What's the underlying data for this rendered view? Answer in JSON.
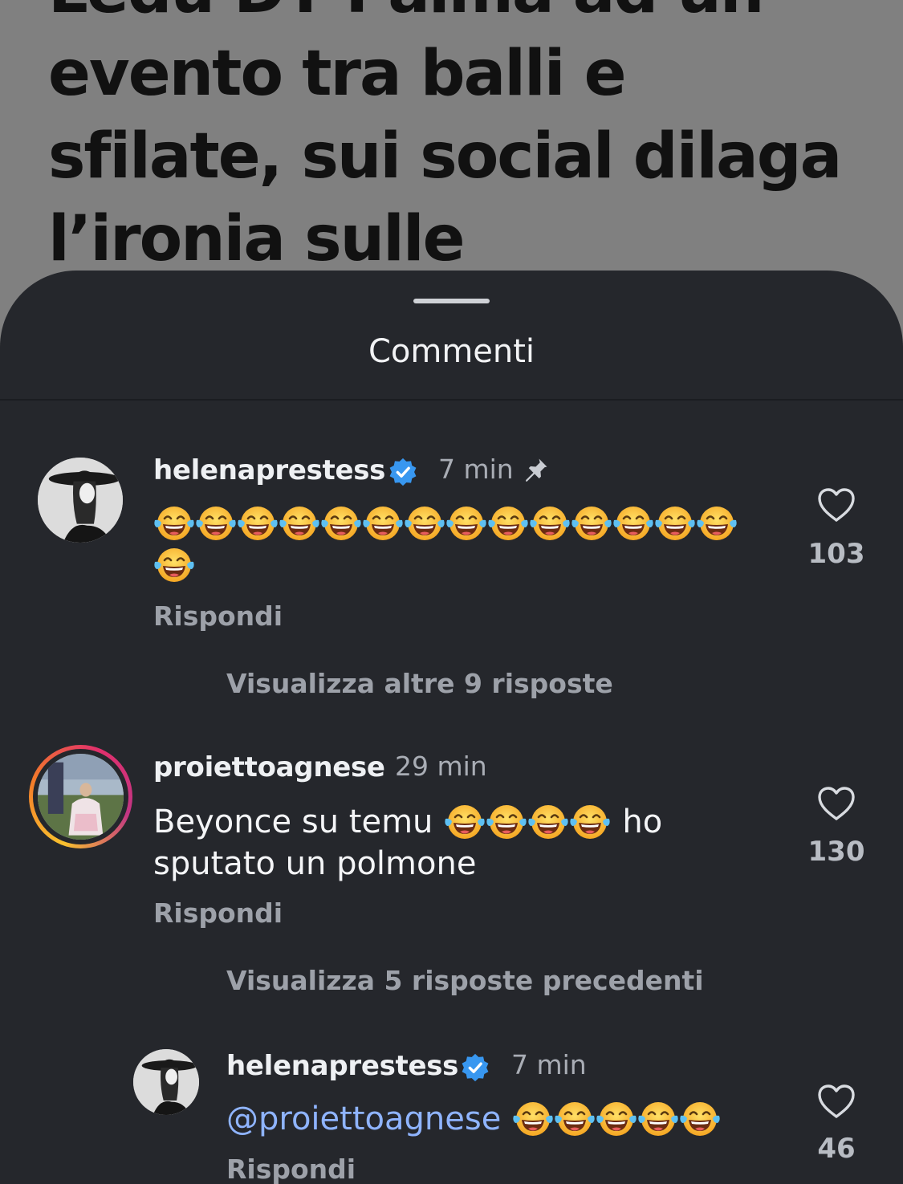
{
  "article": {
    "headline_lines": [
      "Ledu DT Palma ad un",
      "evento tra balli e",
      "sfilate, sui social dilaga",
      "l’ironia sulle"
    ]
  },
  "sheet": {
    "title": "Commenti"
  },
  "comments": [
    {
      "username": "helenaprestess",
      "verified": true,
      "time": "7 min",
      "pinned": true,
      "text": "",
      "emoji": "face-with-tears-of-joy",
      "emoji_count": 15,
      "reply_label": "Rispondi",
      "likes": "103",
      "view_replies_label": "Visualizza altre 9 risposte"
    },
    {
      "username": "proiettoagnese",
      "verified": false,
      "has_story_ring": true,
      "time": "29 min",
      "text_before": "Beyonce su temu",
      "emoji_count": 4,
      "text_after": "ho",
      "text_line2": "sputato un polmone",
      "reply_label": "Rispondi",
      "likes": "130",
      "view_replies_label": "Visualizza 5 risposte precedenti"
    },
    {
      "username": "helenaprestess",
      "verified": true,
      "time": "7 min",
      "mention": "@proiettoagnese",
      "emoji_count": 5,
      "reply_label": "Rispondi",
      "likes": "46",
      "is_reply": true
    }
  ],
  "colors": {
    "sheet_bg": "#25272c",
    "verified_blue": "#3897f0",
    "mention_blue": "#8fb4ff",
    "muted_text": "#9da1a9"
  },
  "icons": [
    "verified-badge-icon",
    "pin-icon",
    "heart-outline-icon",
    "face-with-tears-of-joy-emoji"
  ]
}
